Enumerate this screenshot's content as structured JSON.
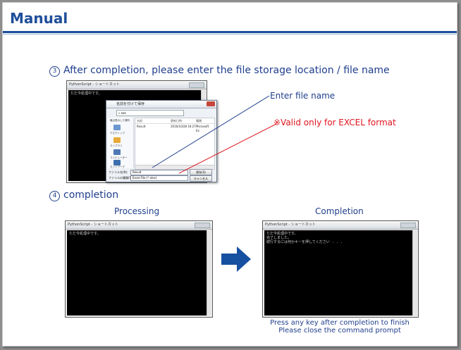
{
  "header": {
    "title": "Manual"
  },
  "step3": {
    "number": "3",
    "text": "After completion, please enter the file storage location / file name",
    "annotation_filename": "Enter file name",
    "annotation_excel": "※Valid only for EXCEL format",
    "annotation_excel_color": "#e0141e",
    "console_title": "PythonScript - ショートカット",
    "console_line": "ただ今処理中です。",
    "dialog": {
      "title": "名前を付けて保存",
      "address": "« exe",
      "sidebar": [
        "最近表示した場所",
        "デスクトップ",
        "ライブラリ",
        "コンピューター",
        "ネットワーク"
      ],
      "columns": [
        "名前",
        "更新日時",
        "種類"
      ],
      "files": [
        {
          "name": "Result",
          "modified": "2016/10/28 16:27",
          "type": "Microsoft Ex"
        }
      ],
      "filename_label": "ファイル名(N):",
      "filename_value": "Result",
      "filetype_label": "ファイルの種類(T):",
      "filetype_value": "Excel File (*.xlsx)",
      "save_label": "保存(S)",
      "cancel_label": "キャンセル"
    }
  },
  "step4": {
    "number": "4",
    "text": "completion",
    "processing_caption": "Processing",
    "completion_caption": "Completion",
    "processing_window": {
      "title": "PythonScript - ショートカット",
      "lines": "ただ今処理中です。"
    },
    "completion_window": {
      "title": "PythonScript - ショートカット",
      "lines": "ただ今処理中です。\n完了しました。\n続行するには何かキーを押してください . . ."
    },
    "note_line1": "Press any key after completion to finish",
    "note_line2": "Please close the command prompt"
  },
  "colors": {
    "accent": "#1e4e9a",
    "text_blue": "#1f3e8c",
    "arrow": "#1650a0"
  },
  "icons": {
    "arrow": "right-arrow-icon"
  }
}
